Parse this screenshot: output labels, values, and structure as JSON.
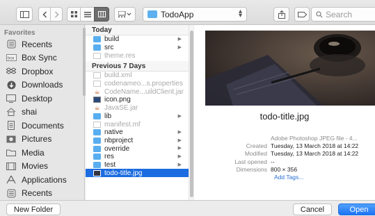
{
  "toolbar": {
    "location": "TodoApp",
    "search_placeholder": "Search",
    "buttons": [
      "sidebar-toggle",
      "back",
      "forward",
      "icon-view",
      "list-view",
      "column-view",
      "gallery-view",
      "share",
      "tags"
    ]
  },
  "sidebar": {
    "heading": "Favorites",
    "items": [
      {
        "label": "Recents",
        "icon": "recents-icon"
      },
      {
        "label": "Box Sync",
        "icon": "box-icon"
      },
      {
        "label": "Dropbox",
        "icon": "dropbox-icon"
      },
      {
        "label": "Downloads",
        "icon": "downloads-icon"
      },
      {
        "label": "Desktop",
        "icon": "desktop-icon"
      },
      {
        "label": "shai",
        "icon": "home-icon"
      },
      {
        "label": "Documents",
        "icon": "documents-icon"
      },
      {
        "label": "Pictures",
        "icon": "pictures-icon"
      },
      {
        "label": "Media",
        "icon": "folder-icon"
      },
      {
        "label": "Movies",
        "icon": "movies-icon"
      },
      {
        "label": "Applications",
        "icon": "applications-icon"
      },
      {
        "label": "Recents",
        "icon": "recents-icon"
      }
    ]
  },
  "browser": {
    "today_label": "Today",
    "previous_label": "Previous 7 Days",
    "today_rows": [
      {
        "name": "build",
        "kind": "folder",
        "dim": false,
        "arrow": true
      },
      {
        "name": "src",
        "kind": "folder",
        "dim": false,
        "arrow": true
      },
      {
        "name": "theme.res",
        "kind": "doc",
        "dim": true,
        "arrow": false
      }
    ],
    "previous_rows": [
      {
        "name": "build.xml",
        "kind": "doc",
        "dim": true,
        "arrow": false
      },
      {
        "name": "codenameo...s.properties",
        "kind": "doc",
        "dim": true,
        "arrow": false
      },
      {
        "name": "CodeName...uildClient.jar",
        "kind": "java",
        "dim": true,
        "arrow": false
      },
      {
        "name": "icon.png",
        "kind": "png",
        "dim": false,
        "arrow": false
      },
      {
        "name": "JavaSE.jar",
        "kind": "java",
        "dim": true,
        "arrow": false
      },
      {
        "name": "lib",
        "kind": "folder",
        "dim": false,
        "arrow": true
      },
      {
        "name": "manifest.mf",
        "kind": "doc",
        "dim": true,
        "arrow": false
      },
      {
        "name": "native",
        "kind": "folder",
        "dim": false,
        "arrow": true
      },
      {
        "name": "nbproject",
        "kind": "folder",
        "dim": false,
        "arrow": true
      },
      {
        "name": "override",
        "kind": "folder",
        "dim": false,
        "arrow": true
      },
      {
        "name": "res",
        "kind": "folder",
        "dim": false,
        "arrow": true
      },
      {
        "name": "test",
        "kind": "folder",
        "dim": false,
        "arrow": true
      },
      {
        "name": "todo-title.jpg",
        "kind": "jpg",
        "dim": false,
        "arrow": false,
        "selected": true
      }
    ]
  },
  "preview": {
    "filename": "todo-title.jpg",
    "kind": "Adobe Photoshop JPEG file - 4...",
    "created_label": "Created",
    "created": "Tuesday, 13 March 2018 at 14:22",
    "modified_label": "Modified",
    "modified": "Tuesday, 13 March 2018 at 14:22",
    "last_opened_label": "Last opened",
    "last_opened": "--",
    "dimensions_label": "Dimensions",
    "dimensions": "800 × 356",
    "add_tags": "Add Tags..."
  },
  "footer": {
    "new_folder": "New Folder",
    "cancel": "Cancel",
    "open": "Open"
  }
}
